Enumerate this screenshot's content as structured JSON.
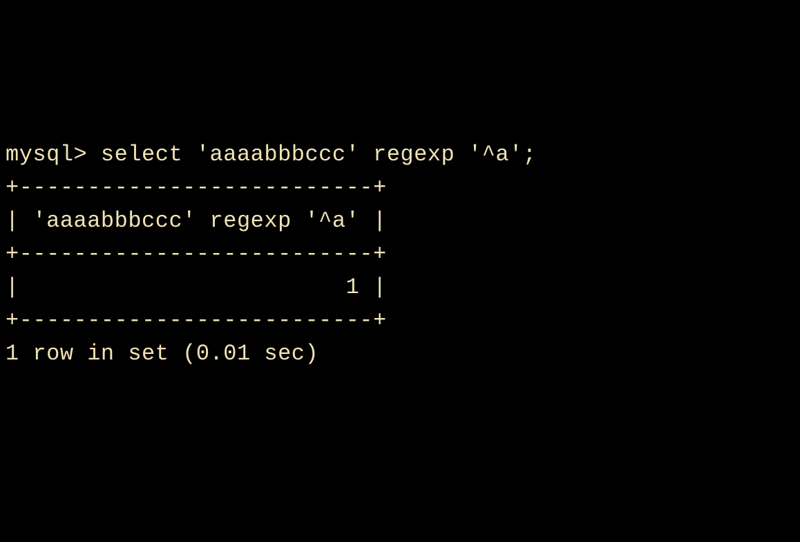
{
  "terminal": {
    "prompt": "mysql>",
    "command": "select 'aaaabbbccc' regexp '^a';",
    "table": {
      "border_top": "+--------------------------+",
      "header_row": "| 'aaaabbbccc' regexp '^a' |",
      "border_mid": "+--------------------------+",
      "data_row": "|                        1 |",
      "border_bottom": "+--------------------------+"
    },
    "status": "1 row in set (0.01 sec)"
  }
}
